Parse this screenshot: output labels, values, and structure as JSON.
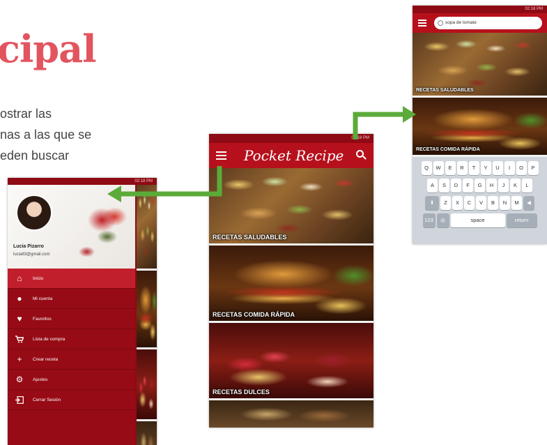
{
  "slide": {
    "title": "cipal",
    "text_lines": [
      "ostrar las",
      "nas a las que se",
      "eden buscar"
    ]
  },
  "status_time": "02:18 PM",
  "colors": {
    "accent": "#b7101d",
    "title": "#e2555f",
    "arrow": "#5cab3a"
  },
  "drawer": {
    "user_name": "Lucia Pizarro",
    "user_email": "lucia83@gmail.com",
    "items": [
      {
        "label": "Inicio",
        "icon": "home-icon"
      },
      {
        "label": "Mi cuenta",
        "icon": "person-icon"
      },
      {
        "label": "Favoritos",
        "icon": "heart-icon"
      },
      {
        "label": "Lista de compra",
        "icon": "cart-icon"
      },
      {
        "label": "Crear receta",
        "icon": "plus-icon"
      },
      {
        "label": "Ajustes",
        "icon": "gear-icon"
      },
      {
        "label": "Cerrar Sesión",
        "icon": "logout-icon"
      }
    ]
  },
  "main": {
    "app_title": "Pocket Recipe",
    "cards": [
      {
        "label": "RECETAS SALUDABLES"
      },
      {
        "label": "RECETAS COMIDA RÁPIDA"
      },
      {
        "label": "RECETAS DULCES"
      },
      {
        "label": ""
      }
    ]
  },
  "search": {
    "query": "sopa de tomate",
    "cards": [
      {
        "label": "RECETAS SALUDABLES"
      },
      {
        "label": "RECETAS COMIDA RÁPIDA"
      }
    ],
    "keyboard": {
      "row1": [
        "Q",
        "W",
        "E",
        "R",
        "T",
        "Y",
        "U",
        "I",
        "O",
        "P"
      ],
      "row2": [
        "A",
        "S",
        "D",
        "F",
        "G",
        "H",
        "J",
        "K",
        "L"
      ],
      "row3": [
        "Z",
        "X",
        "C",
        "V",
        "B",
        "N",
        "M"
      ],
      "numbers_key": "123",
      "space_key": "space",
      "return_key": "return"
    }
  }
}
